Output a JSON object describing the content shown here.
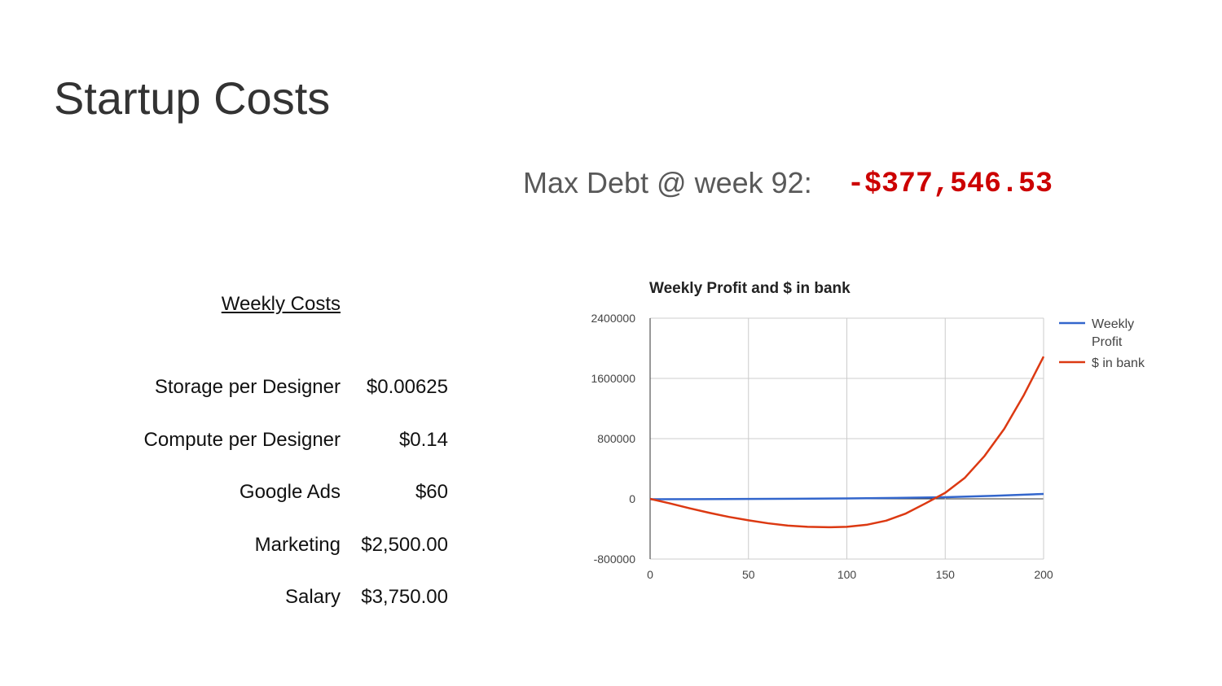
{
  "title": "Startup Costs",
  "max_debt": {
    "label": "Max Debt @ week 92:",
    "value": "-$377,546.53",
    "color": "#cc0000"
  },
  "weekly_costs": {
    "heading": "Weekly Costs",
    "rows": [
      {
        "label": "Storage per Designer",
        "value": "$0.00625"
      },
      {
        "label": "Compute per Designer",
        "value": "$0.14"
      },
      {
        "label": "Google Ads",
        "value": "$60"
      },
      {
        "label": "Marketing",
        "value": "$2,500.00"
      },
      {
        "label": "Salary",
        "value": "$3,750.00"
      }
    ]
  },
  "chart_data": {
    "type": "line",
    "title": "Weekly Profit and $ in bank",
    "xlabel": "",
    "ylabel": "",
    "xlim": [
      0,
      200
    ],
    "ylim": [
      -800000,
      2400000
    ],
    "x_ticks": [
      "0",
      "50",
      "100",
      "150",
      "200"
    ],
    "y_ticks": [
      "2400000",
      "1600000",
      "800000",
      "0",
      "-800000"
    ],
    "grid": true,
    "legend_position": "right",
    "series": [
      {
        "name": "Weekly Profit",
        "color": "#3366cc",
        "x": [
          0,
          25,
          50,
          75,
          100,
          125,
          150,
          175,
          200
        ],
        "y": [
          -6000,
          -4000,
          -2000,
          2000,
          6000,
          12000,
          22000,
          40000,
          65000
        ]
      },
      {
        "name": "$ in bank",
        "color": "#dc3912",
        "x": [
          0,
          10,
          20,
          30,
          40,
          50,
          60,
          70,
          80,
          92,
          100,
          110,
          120,
          130,
          140,
          150,
          160,
          170,
          180,
          190,
          200
        ],
        "y": [
          0,
          -60000,
          -125000,
          -185000,
          -240000,
          -285000,
          -325000,
          -355000,
          -372000,
          -377546,
          -372000,
          -345000,
          -290000,
          -195000,
          -60000,
          80000,
          280000,
          570000,
          930000,
          1380000,
          1890000
        ]
      }
    ]
  }
}
